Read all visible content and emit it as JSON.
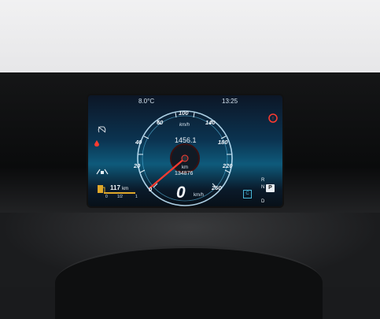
{
  "cluster": {
    "outside_temp": "8.0°C",
    "clock": "13:25",
    "trip_distance": "1456.1",
    "speed_unit_top": "km/h",
    "odometer_unit": "km",
    "odometer": "134876",
    "current_speed": "0",
    "current_speed_unit": "km/h",
    "range_value": "117",
    "range_unit": "km",
    "gear_selector": [
      "R",
      "N",
      "P",
      "D"
    ],
    "drive_mode": "C",
    "parking_indicator": "P",
    "speedometer_ticks": [
      "0",
      "20",
      "40",
      "60",
      "100",
      "140",
      "180",
      "220",
      "260"
    ],
    "fuel_marks": [
      "0",
      "1/2",
      "1"
    ],
    "icons": {
      "left_top": "tire-pressure-icon",
      "left_warning": "engine-warning-icon",
      "left_mid": "lane-assist-icon",
      "left_fuel": "fuel-pump-icon",
      "right_top": "parking-brake-icon"
    },
    "colors": {
      "accent": "#ff3b30",
      "screen_blue": "#0e5a7b",
      "ring": "#cfe7f7"
    }
  }
}
